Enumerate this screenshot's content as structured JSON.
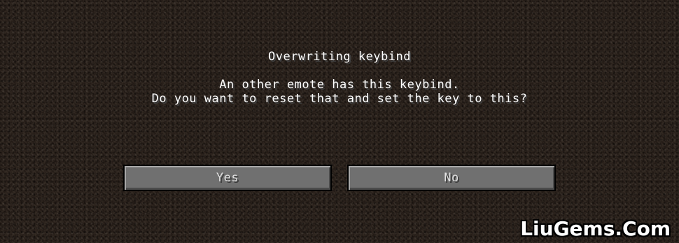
{
  "dialog": {
    "title": "Overwriting keybind",
    "message_line1": "An other emote has this keybind.",
    "message_line2": "Do you want to reset that and set the key to this?"
  },
  "buttons": {
    "yes_label": "Yes",
    "no_label": "No"
  },
  "watermark": {
    "text": "LiuGems.Com"
  },
  "colors": {
    "background": "#2a211a",
    "button_face": "#707070",
    "text": "#ffffff"
  }
}
